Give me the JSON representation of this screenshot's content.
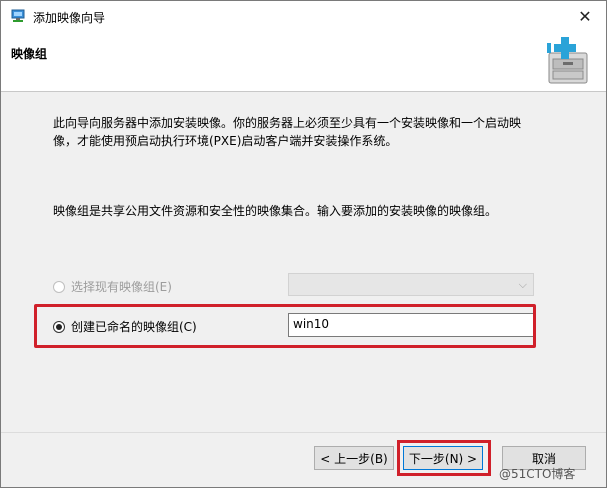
{
  "window": {
    "title": "添加映像向导",
    "close_glyph": "✕"
  },
  "header": {
    "title": "映像组",
    "art_icon": "add-image-store-icon"
  },
  "content": {
    "paragraph1": "此向导向服务器中添加安装映像。你的服务器上必须至少具有一个安装映像和一个启动映像，才能使用预启动执行环境(PXE)启动客户端并安装操作系统。",
    "paragraph2": "映像组是共享公用文件资源和安全性的映像集合。输入要添加的安装映像的映像组。",
    "option_existing": {
      "label": "选择现有映像组(E)",
      "selected": false,
      "enabled": false,
      "dropdown_value": ""
    },
    "option_new": {
      "label": "创建已命名的映像组(C)",
      "selected": true,
      "enabled": true,
      "input_value": "win10"
    }
  },
  "footer": {
    "back_label": "< 上一步(B)",
    "next_label": "下一步(N) >",
    "cancel_label": "取消"
  },
  "watermark": "@51CTO博客",
  "colors": {
    "highlight": "#d0202a",
    "content_bg": "#f0f0f0",
    "focus_border": "#0078d7"
  }
}
